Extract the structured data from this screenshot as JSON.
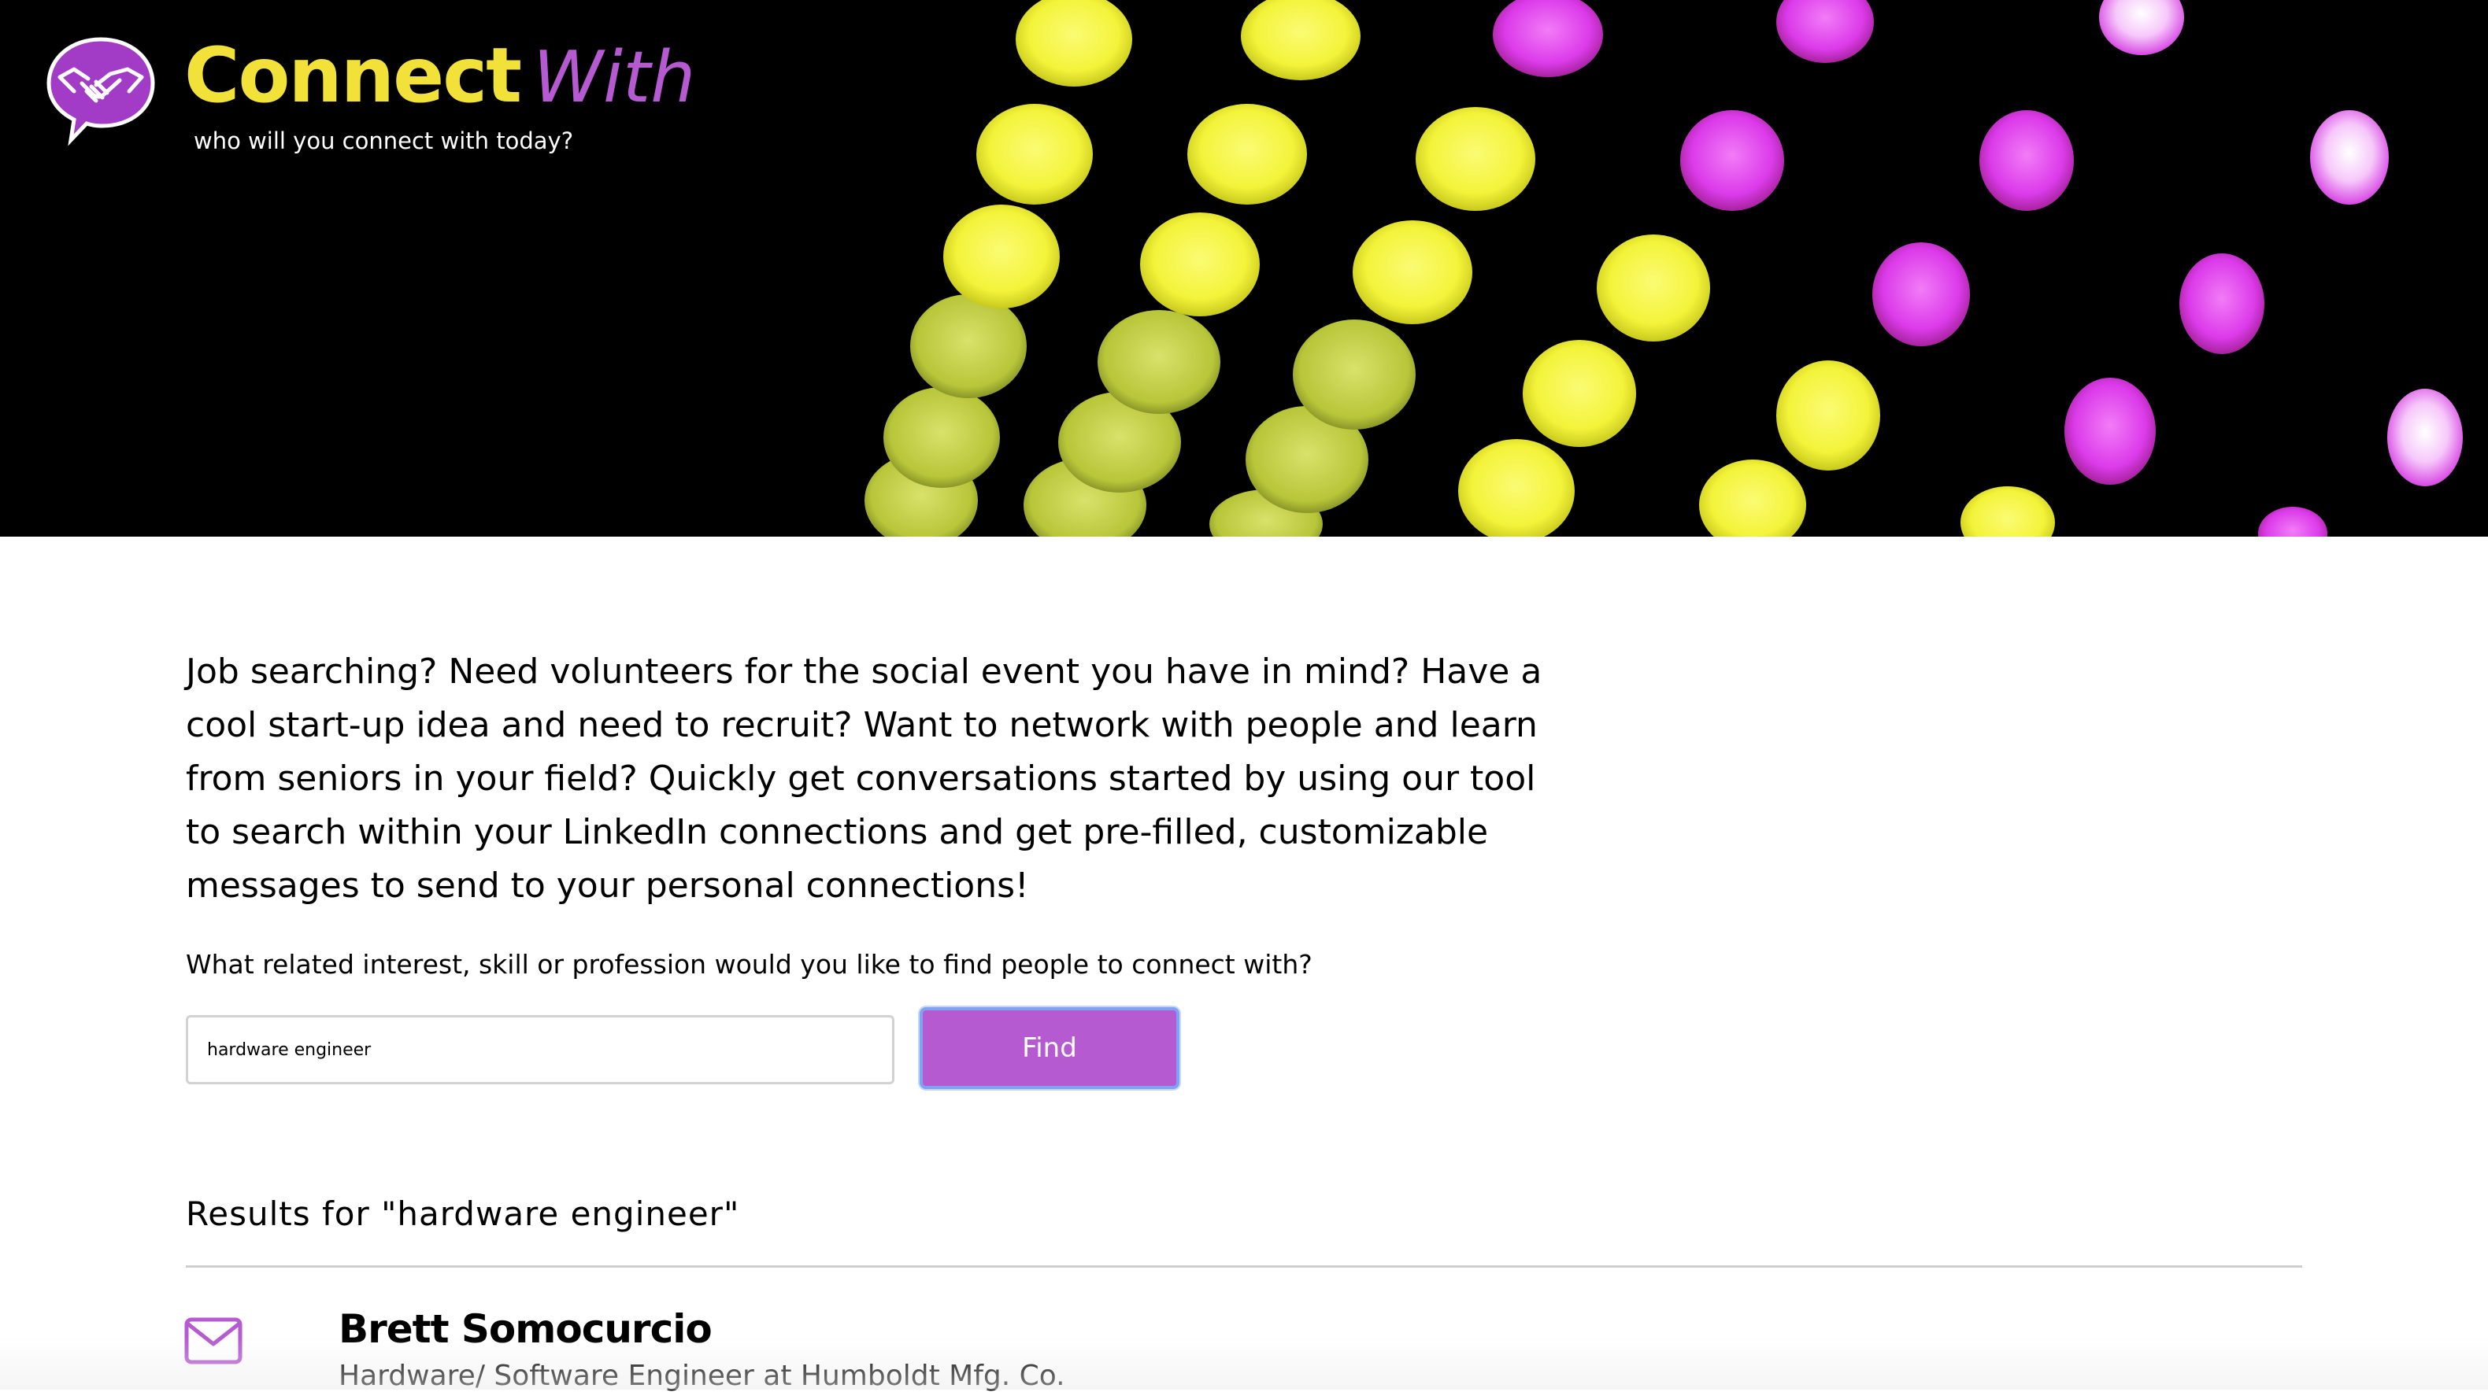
{
  "brand": {
    "name_part1": "Connect",
    "name_part2": "With",
    "tagline": "who will you connect with today?",
    "logo_icon": "handshake-speech-bubble-icon"
  },
  "colors": {
    "accent_yellow": "#f1e138",
    "accent_purple": "#b55ad0",
    "banner_background": "#000000",
    "focus_ring": "#7fa3f2"
  },
  "intro": {
    "text": "Job searching? Need volunteers for the social event you have in mind? Have a cool start-up idea and need to recruit? Want to network with people and learn from seniors in your field? Quickly get conversations started by using our tool to search within your LinkedIn connections and get pre-filled, customizable messages to send to your personal connections!"
  },
  "search": {
    "question": "What related interest, skill or profession would you like to find people to connect with?",
    "value": "hardware engineer",
    "button_label": "Find"
  },
  "results": {
    "heading": "Results for \"hardware engineer\"",
    "items": [
      {
        "name": "Brett Somocurcio",
        "title": "Hardware/ Software Engineer at Humboldt Mfg. Co.",
        "action_icon": "envelope-icon"
      }
    ]
  }
}
